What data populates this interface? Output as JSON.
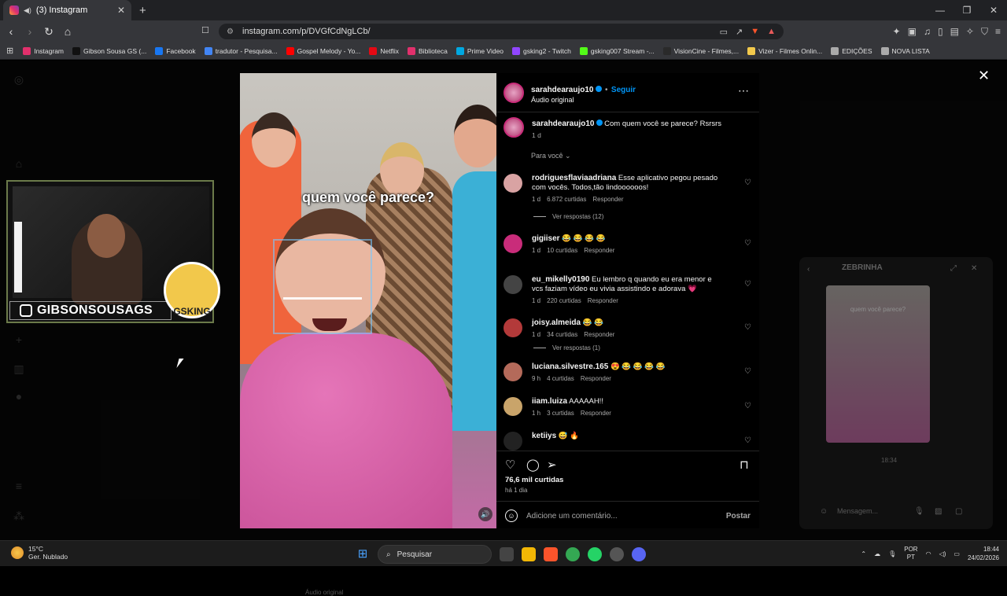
{
  "browser": {
    "tab_title": "(3) Instagram",
    "url": "instagram.com/p/DVGfCdNgLCb/",
    "bookmarks": [
      "Instagram",
      "Gibson Sousa GS (...",
      "Facebook",
      "tradutor - Pesquisa...",
      "Gospel Melody - Yo...",
      "Netflix",
      "Biblioteca",
      "Prime Video",
      "gsking2 - Twitch",
      "gsking007 Stream -...",
      "VisionCine - Filmes,...",
      "Vizer - Filmes Onlin...",
      "EDIÇÕES",
      "NOVA LISTA"
    ],
    "bookmark_colors": [
      "#e1306c",
      "#111111",
      "#1877f2",
      "#4285f4",
      "#ff0000",
      "#e50914",
      "#e1306c",
      "#00a8e1",
      "#9146ff",
      "#53fc18",
      "#2a2a2a",
      "#f2c94c",
      "#aaaaaa",
      "#aaaaaa"
    ]
  },
  "post": {
    "username": "sarahdearaujo10",
    "follow_label": "Seguir",
    "audio_label": "Áudio original",
    "caption": "Com quem você se parece? Rsrsrs",
    "caption_time": "1 d",
    "sort_label": "Para você",
    "video_text": "quem você parece?",
    "likes": "76,6 mil curtidas",
    "posted": "há 1 dia",
    "comment_placeholder": "Adicione um comentário...",
    "post_button": "Postar"
  },
  "comments": [
    {
      "user": "rodriguesflaviaadriana",
      "text": "Esse aplicativo pegou pesado com vocês. Todos,tão lindoooooos!",
      "time": "1 d",
      "likes": "6.872 curtidas",
      "reply": "Responder",
      "view_replies": "Ver respostas (12)",
      "avatar": "#d9a3a3"
    },
    {
      "user": "gigiiser",
      "text": "😂 😂 😂 😂",
      "time": "1 d",
      "likes": "10 curtidas",
      "reply": "Responder",
      "view_replies": "",
      "avatar": "#c92c7a"
    },
    {
      "user": "eu_mikelly0190",
      "text": "Eu lembro q quando eu era menor e vcs faziam vídeo eu vivia assistindo e adorava 💗",
      "time": "1 d",
      "likes": "220 curtidas",
      "reply": "Responder",
      "view_replies": "",
      "avatar": "#444444"
    },
    {
      "user": "joisy.almeida",
      "text": "😂 😂",
      "time": "1 d",
      "likes": "34 curtidas",
      "reply": "Responder",
      "view_replies": "Ver respostas (1)",
      "avatar": "#b33a3a"
    },
    {
      "user": "luciana.silvestre.165",
      "text": "😍 😂 😂 😂 😂",
      "time": "9 h",
      "likes": "4 curtidas",
      "reply": "Responder",
      "view_replies": "",
      "avatar": "#b46a5a"
    },
    {
      "user": "iiam.luiza",
      "text": "AAAAAH!!",
      "time": "1 h",
      "likes": "3 curtidas",
      "reply": "Responder",
      "view_replies": "",
      "avatar": "#c9a46a"
    },
    {
      "user": "ketiiys",
      "text": "😅 🔥",
      "time": "",
      "likes": "",
      "reply": "",
      "view_replies": "",
      "avatar": "#222222"
    }
  ],
  "stream_overlay": {
    "handle": "GIBSONSOUSAGS",
    "logo": "GSKING"
  },
  "mini_chat": {
    "title": "ZEBRINHA",
    "thumb_text": "quem você parece?",
    "time": "18:34",
    "message_placeholder": "Mensagem..."
  },
  "behind_text": "Áudio original",
  "taskbar": {
    "temp": "15°C",
    "weather": "Ger. Nublado",
    "search": "Pesquisar",
    "lang1": "POR",
    "lang2": "PT",
    "time": "18:44",
    "date": "24/02/2026"
  }
}
